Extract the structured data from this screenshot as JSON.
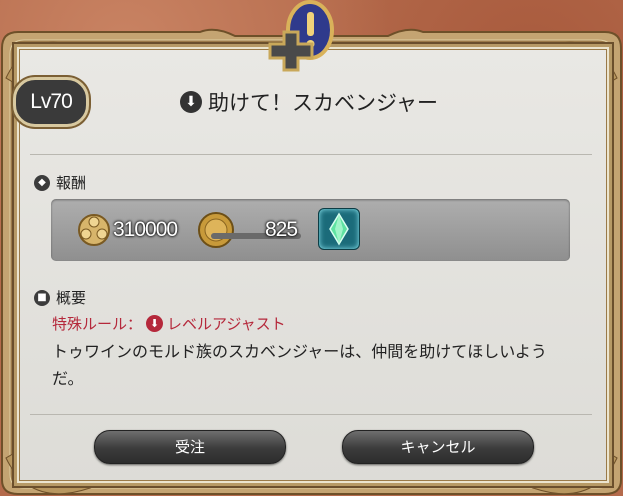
{
  "dialog": {
    "level_badge": "Lv70",
    "title": "助けて！スカベンジャー"
  },
  "rewards": {
    "label": "報酬",
    "gil_amount": "310000",
    "exp_amount": "825"
  },
  "summary": {
    "label": "概要",
    "rule_prefix": "特殊ルール：",
    "rule_name": "レベルアジャスト",
    "description": "トゥワインのモルド族のスカベンジャーは、仲間を助けてほしいようだ。"
  },
  "buttons": {
    "accept": "受注",
    "cancel": "キャンセル"
  },
  "colors": {
    "rule_red": "#b5283b",
    "panel_bg": "#e9e8e4",
    "frame_gold": "#b79a66"
  }
}
